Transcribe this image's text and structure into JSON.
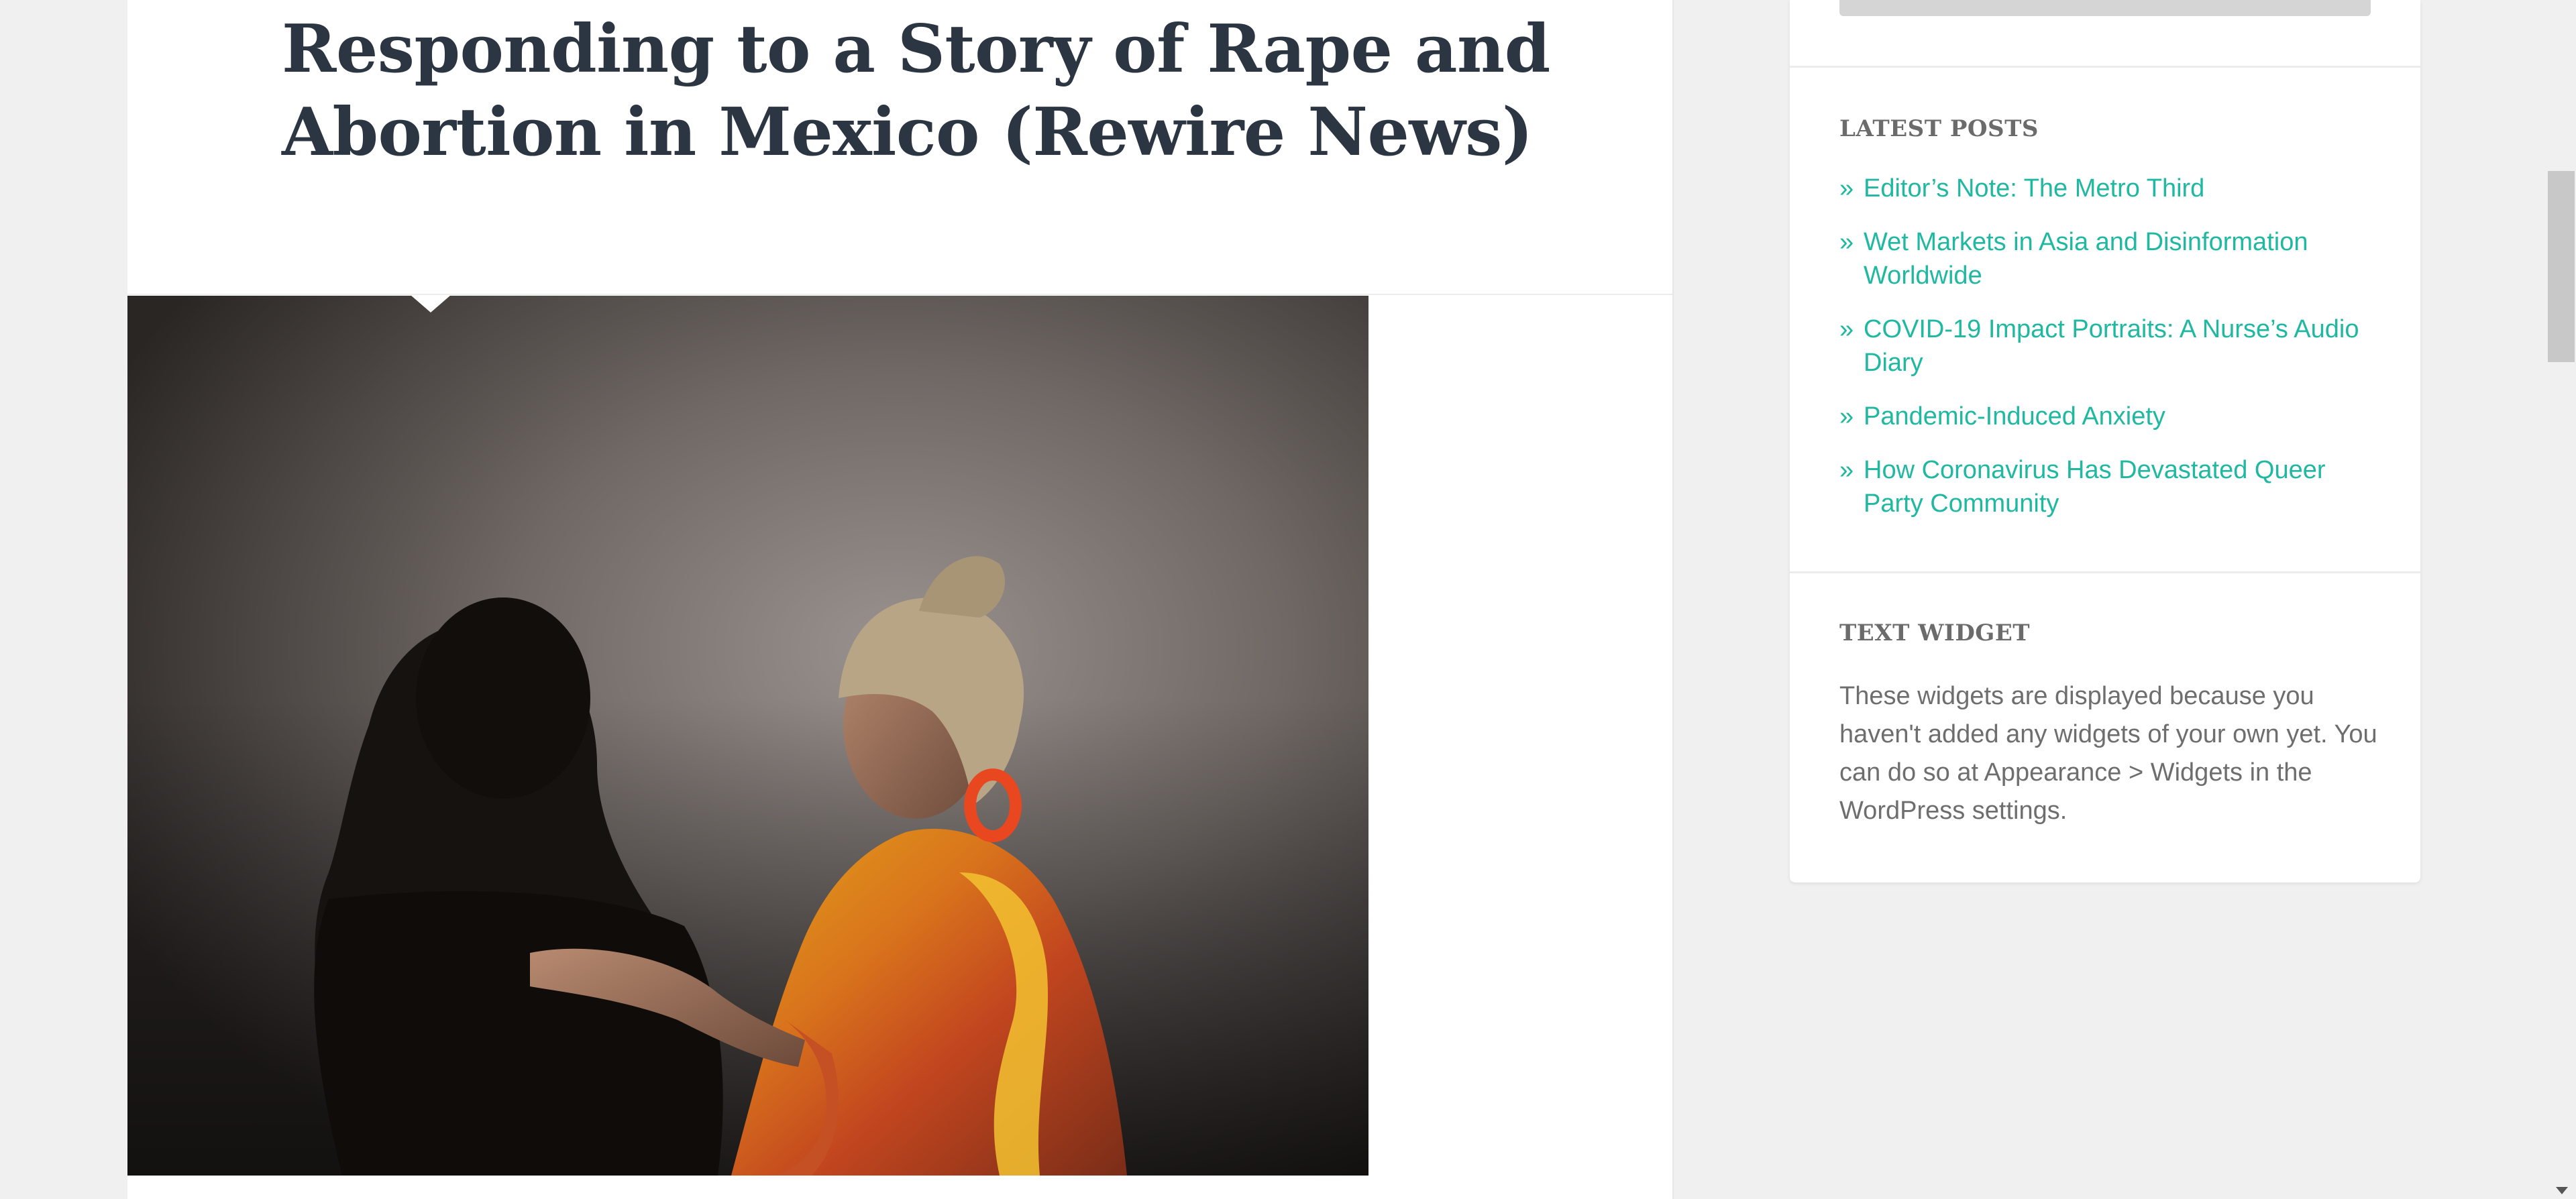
{
  "article": {
    "title": "Responding to a Story of Rape and Abortion in Mexico (Rewire News)",
    "featured_image_alt": "Two women standing together; one places a hand on the other's back"
  },
  "sidebar": {
    "latest_posts": {
      "title": "LATEST POSTS",
      "bullet": "»",
      "items": [
        {
          "label": "Editor’s Note: The Metro Third"
        },
        {
          "label": "Wet Markets in Asia and Disinformation Worldwide"
        },
        {
          "label": "COVID-19 Impact Portraits: A Nurse’s Audio Diary"
        },
        {
          "label": "Pandemic-Induced Anxiety"
        },
        {
          "label": "How Coronavirus Has Devastated Queer Party Community"
        }
      ]
    },
    "text_widget": {
      "title": "TEXT WIDGET",
      "body": "These widgets are displayed because you haven't added any widgets of your own yet. You can do so at Appearance > Widgets in the WordPress settings."
    }
  },
  "colors": {
    "background": "#f0f0f0",
    "title": "#2c3542",
    "link_accent": "#1fb8a1",
    "widget_title": "#6b6b6b",
    "body_text": "#6e6e6e"
  },
  "icons": {
    "scroll_down": "chevron-down-icon"
  }
}
